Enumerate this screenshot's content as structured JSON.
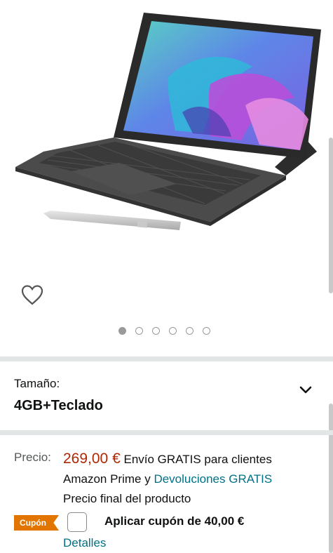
{
  "product": {
    "image_alt": "Tablet con teclado y lápiz",
    "gallery_count": 6,
    "gallery_active_index": 0
  },
  "size": {
    "label": "Tamaño:",
    "value": "4GB+Teclado"
  },
  "price": {
    "label": "Precio:",
    "amount": "269,00 €",
    "shipping_text": "Envío GRATIS para clientes Amazon Prime y",
    "returns_link": "Devoluciones GRATIS",
    "final_note": "Precio final del producto"
  },
  "coupon": {
    "badge": "Cupón",
    "text": "Aplicar cupón de 40,00 €",
    "details_link": "Detalles"
  },
  "icons": {
    "wishlist": "heart-outline-icon",
    "dropdown": "chevron-down-icon"
  },
  "colors": {
    "price": "#B12704",
    "link": "#007185",
    "coupon_badge": "#E17500",
    "divider": "#E3E6E6"
  }
}
